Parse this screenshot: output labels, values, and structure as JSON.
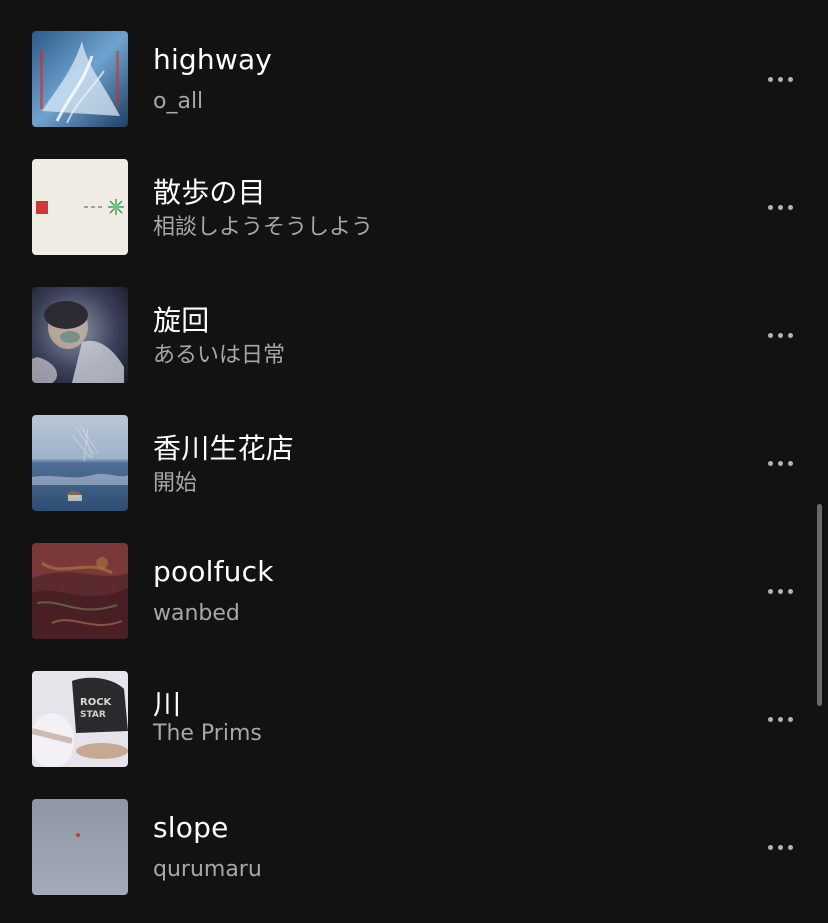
{
  "tracks": [
    {
      "title": "highway",
      "artist": "o_all",
      "cover": "highway-cover-art",
      "more_icon": "more-horizontal-icon"
    },
    {
      "title": "散歩の目",
      "artist": "相談しようそうしよう",
      "cover": "sanpo-no-me-cover-art",
      "more_icon": "more-horizontal-icon"
    },
    {
      "title": "旋回",
      "artist": "あるいは日常",
      "cover": "senkai-cover-art",
      "more_icon": "more-horizontal-icon"
    },
    {
      "title": "香川生花店",
      "artist": "開始",
      "cover": "kagawa-seikaten-cover-art",
      "more_icon": "more-horizontal-icon"
    },
    {
      "title": "poolfuck",
      "artist": "wanbed",
      "cover": "poolfuck-cover-art",
      "more_icon": "more-horizontal-icon"
    },
    {
      "title": "川",
      "artist": "The Prims",
      "cover": "kawa-cover-art",
      "more_icon": "more-horizontal-icon"
    },
    {
      "title": "slope",
      "artist": "qurumaru",
      "cover": "slope-cover-art",
      "more_icon": "more-horizontal-icon"
    }
  ],
  "colors": {
    "background": "#121212",
    "title_text": "#ffffff",
    "subtitle_text": "#a7a7a7",
    "icon": "#b3b3b3"
  }
}
